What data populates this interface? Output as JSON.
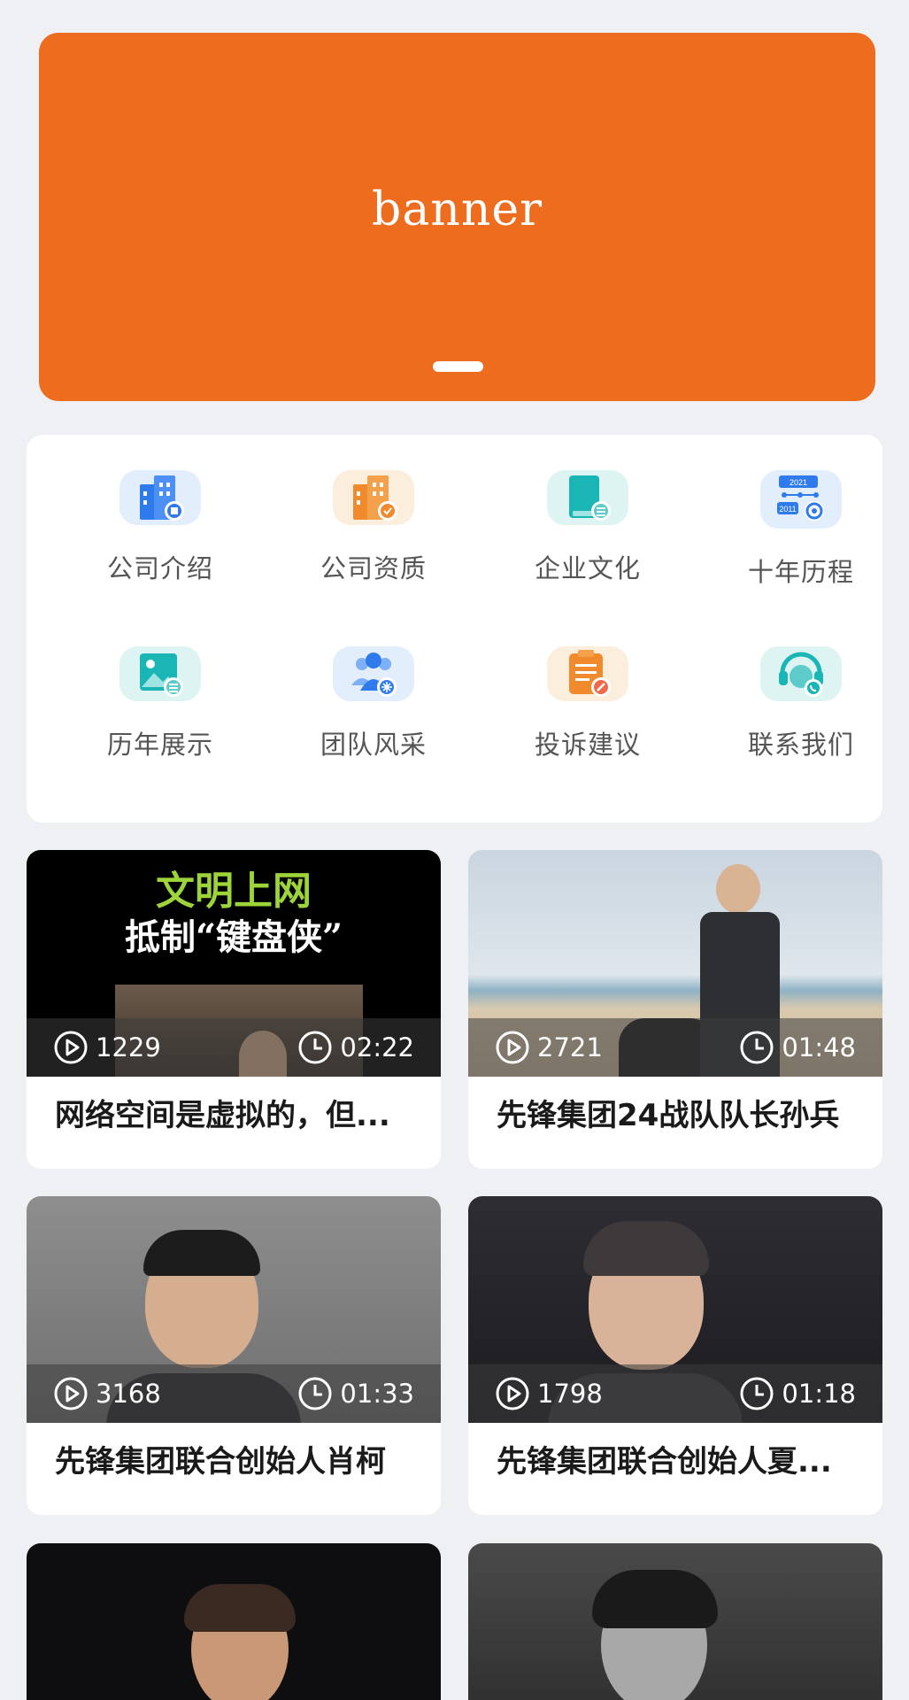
{
  "banner": {
    "text": "banner"
  },
  "menu": {
    "items": [
      {
        "label": "公司介绍",
        "icon": "company-building-icon"
      },
      {
        "label": "公司资质",
        "icon": "qualification-building-icon"
      },
      {
        "label": "企业文化",
        "icon": "culture-book-icon"
      },
      {
        "label": "十年历程",
        "icon": "timeline-icon"
      },
      {
        "label": "历年展示",
        "icon": "gallery-image-icon"
      },
      {
        "label": "团队风采",
        "icon": "team-people-icon"
      },
      {
        "label": "投诉建议",
        "icon": "complaint-clipboard-icon"
      },
      {
        "label": "联系我们",
        "icon": "customer-service-headset-icon"
      }
    ],
    "timeline_years": [
      "2021",
      "2011"
    ]
  },
  "videos": [
    {
      "title": "网络空间是虚拟的，但...",
      "views": "1229",
      "duration": "02:22",
      "thumb_caption_top": "文明上网",
      "thumb_caption_bottom": "抵制“键盘侠”"
    },
    {
      "title": "先锋集团24战队队长孙兵",
      "views": "2721",
      "duration": "01:48"
    },
    {
      "title": "先锋集团联合创始人肖柯",
      "views": "3168",
      "duration": "01:33"
    },
    {
      "title": "先锋集团联合创始人夏...",
      "views": "1798",
      "duration": "01:18"
    },
    {
      "title": "",
      "views": "",
      "duration": ""
    },
    {
      "title": "",
      "views": "",
      "duration": ""
    }
  ],
  "colors": {
    "accent": "#EE6C1D",
    "background": "#EEF0F3",
    "icon_blue": "#2F7BEB",
    "icon_orange": "#F08A2C",
    "icon_teal": "#19B6B5"
  }
}
